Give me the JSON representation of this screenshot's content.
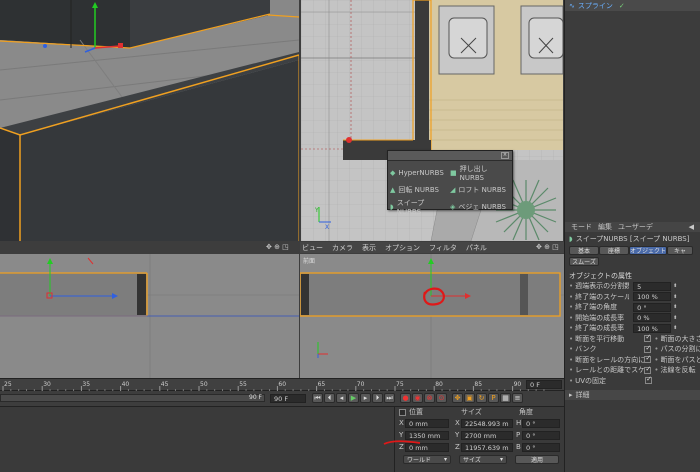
{
  "object_manager": {
    "item_label": "スプライン"
  },
  "viewport_top_right": {
    "nurbs_popup": {
      "items": [
        "HyperNURBS",
        "押し出し NURBS",
        "回転 NURBS",
        "ロフト NURBS",
        "スイープ NURBS",
        "ベジェ NURBS"
      ]
    }
  },
  "viewport_front": {
    "menu": [
      "ビュー",
      "カメラ",
      "表示",
      "オプション",
      "フィルタ",
      "パネル"
    ],
    "label": "前面"
  },
  "attribute_manager": {
    "menu": [
      "モード",
      "編集",
      "ユーザーデ"
    ],
    "title": "スイープNURBS [スイープ NURBS]",
    "tabs": [
      "基本",
      "座標",
      "オブジェクト",
      "キャ"
    ],
    "subtab": "スムーズ",
    "section_title": "オブジェクトの属性",
    "props": [
      {
        "label": "週端表示の分割数",
        "value": "5"
      },
      {
        "label": "終了端のスケール",
        "value": "100 %"
      },
      {
        "label": "終了端の角度",
        "value": "0 °"
      },
      {
        "label": "開始端の成長率",
        "value": "0 %"
      },
      {
        "label": "終了端の成長率",
        "value": "100 %"
      }
    ],
    "checks": [
      {
        "left": "断面を平行移動",
        "right": "断面の大きさで"
      },
      {
        "left": "バンク",
        "right": "パスの分割に"
      },
      {
        "left": "断面をレールの方向に",
        "right": "断面をパスとレ"
      },
      {
        "left": "レールとの距離でスケール",
        "right": "法線を反転"
      },
      {
        "left": "UVの固定",
        "right": ""
      }
    ],
    "detail": "詳細"
  },
  "timeline": {
    "ticks": [
      "25",
      "30",
      "35",
      "40",
      "45",
      "50",
      "55",
      "60",
      "65",
      "70",
      "75",
      "80",
      "85",
      "90"
    ],
    "frame_end": "90 F",
    "frame_field": "90 F",
    "current_frame": "0 F"
  },
  "coordinates": {
    "headers": [
      "位置",
      "サイズ",
      "角度"
    ],
    "rows": [
      {
        "axis": "X",
        "pos": "0 mm",
        "size_axis": "X",
        "size": "22548.993 m",
        "rot_axis": "H",
        "rot": "0 °"
      },
      {
        "axis": "Y",
        "pos": "1350 mm",
        "size_axis": "Y",
        "size": "2700 mm",
        "rot_axis": "P",
        "rot": "0 °"
      },
      {
        "axis": "Z",
        "pos": "0 mm",
        "size_axis": "Z",
        "size": "11957.639 m",
        "rot_axis": "B",
        "rot": "0 °"
      }
    ],
    "world_dropdown": "ワールド",
    "size_dropdown": "サイズ",
    "apply_button": "適用"
  },
  "colors": {
    "selection_orange": "#f0a020",
    "annotation_red": "#e01818",
    "axis_y": "#22cc22",
    "axis_x": "#e03030",
    "axis_z": "#3060e0"
  }
}
